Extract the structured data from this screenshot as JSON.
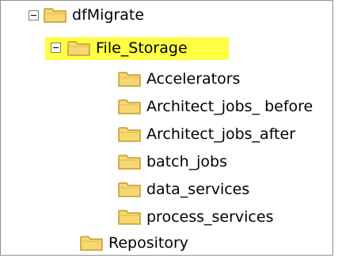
{
  "tree": {
    "root": {
      "label": "dfMigrate",
      "toggle": "minus"
    },
    "selected": {
      "label": "File_Storage",
      "toggle": "minus",
      "highlight_color": "#ffff44"
    },
    "children": [
      {
        "label": "Accelerators"
      },
      {
        "label": "Architect_jobs_ before"
      },
      {
        "label": "Architect_jobs_after"
      },
      {
        "label": "batch_jobs"
      },
      {
        "label": "data_services"
      },
      {
        "label": "process_services"
      }
    ],
    "sibling": {
      "label": "Repository"
    }
  },
  "colors": {
    "folder_fill": "#f7d772",
    "folder_edge": "#c49a2c",
    "border": "#8f8f8f"
  },
  "icons": {
    "folder": "folder-icon",
    "collapse": "collapse-toggle-icon"
  }
}
